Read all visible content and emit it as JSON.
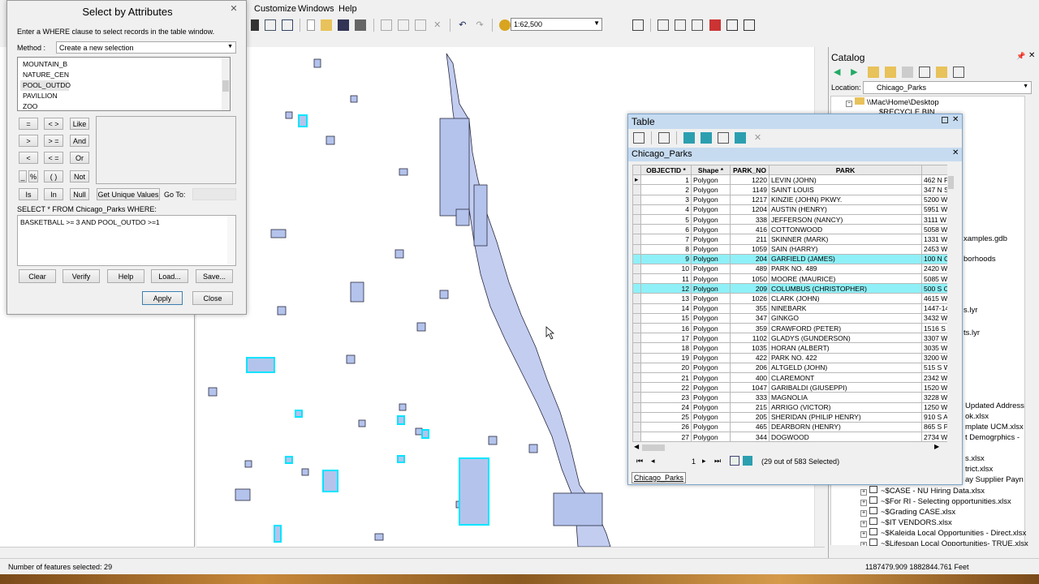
{
  "menu": {
    "items": [
      "Customize",
      "Windows",
      "Help"
    ]
  },
  "toolbar": {
    "scale": "1:62,500"
  },
  "dialog": {
    "title": "Select by Attributes",
    "instructions": "Enter a WHERE clause to select records in the table window.",
    "method_label": "Method :",
    "method_value": "Create a new selection",
    "fields": [
      "MOUNTAIN_B",
      "NATURE_CEN",
      "POOL_OUTDO",
      "PAVILLION",
      "ZOO"
    ],
    "operators": [
      "=",
      "< >",
      "Like",
      ">",
      "> =",
      "And",
      "<",
      "< =",
      "Or",
      "_",
      "%",
      "( )",
      "Not"
    ],
    "is_label": "Is",
    "in_label": "In",
    "null_label": "Null",
    "unique_label": "Get Unique Values",
    "goto_label": "Go To:",
    "select_clause": "SELECT * FROM Chicago_Parks WHERE:",
    "where_text": "BASKETBALL >= 3 AND POOL_OUTDO >=1",
    "clear": "Clear",
    "verify": "Verify",
    "help": "Help",
    "load": "Load...",
    "save": "Save...",
    "apply": "Apply",
    "close": "Close"
  },
  "table": {
    "title": "Table",
    "layer": "Chicago_Parks",
    "columns": [
      "OBJECTID *",
      "Shape *",
      "PARK_NO",
      "PARK"
    ],
    "rows": [
      {
        "id": "1",
        "shape": "Polygon",
        "no": "1220",
        "park": "LEVIN (JOHN)",
        "addr": "462 N Pi",
        "sel": false
      },
      {
        "id": "2",
        "shape": "Polygon",
        "no": "1149",
        "park": "SAINT LOUIS",
        "addr": "347 N S",
        "sel": false
      },
      {
        "id": "3",
        "shape": "Polygon",
        "no": "1217",
        "park": "KINZIE (JOHN) PKWY.",
        "addr": "5200 W",
        "sel": false
      },
      {
        "id": "4",
        "shape": "Polygon",
        "no": "1204",
        "park": "AUSTIN (HENRY)",
        "addr": "5951 W",
        "sel": false
      },
      {
        "id": "5",
        "shape": "Polygon",
        "no": "338",
        "park": "JEFFERSON (NANCY)",
        "addr": "3111 W",
        "sel": false
      },
      {
        "id": "6",
        "shape": "Polygon",
        "no": "416",
        "park": "COTTONWOOD",
        "addr": "5058 W",
        "sel": false
      },
      {
        "id": "7",
        "shape": "Polygon",
        "no": "211",
        "park": "SKINNER (MARK)",
        "addr": "1331 W",
        "sel": false
      },
      {
        "id": "8",
        "shape": "Polygon",
        "no": "1059",
        "park": "SAIN (HARRY)",
        "addr": "2453 W",
        "sel": false
      },
      {
        "id": "9",
        "shape": "Polygon",
        "no": "204",
        "park": "GARFIELD (JAMES)",
        "addr": "100 N C",
        "sel": true
      },
      {
        "id": "10",
        "shape": "Polygon",
        "no": "489",
        "park": "PARK NO. 489",
        "addr": "2420 W",
        "sel": false
      },
      {
        "id": "11",
        "shape": "Polygon",
        "no": "1050",
        "park": "MOORE (MAURICE)",
        "addr": "5085 W",
        "sel": false
      },
      {
        "id": "12",
        "shape": "Polygon",
        "no": "209",
        "park": "COLUMBUS (CHRISTOPHER)",
        "addr": "500 S C",
        "sel": true
      },
      {
        "id": "13",
        "shape": "Polygon",
        "no": "1026",
        "park": "CLARK (JOHN)",
        "addr": "4615 W",
        "sel": false
      },
      {
        "id": "14",
        "shape": "Polygon",
        "no": "355",
        "park": "NINEBARK",
        "addr": "1447-14",
        "sel": false
      },
      {
        "id": "15",
        "shape": "Polygon",
        "no": "347",
        "park": "GINKGO",
        "addr": "3432 W",
        "sel": false
      },
      {
        "id": "16",
        "shape": "Polygon",
        "no": "359",
        "park": "CRAWFORD (PETER)",
        "addr": "1516 S I",
        "sel": false
      },
      {
        "id": "17",
        "shape": "Polygon",
        "no": "1102",
        "park": "GLADYS (GUNDERSON)",
        "addr": "3307 W",
        "sel": false
      },
      {
        "id": "18",
        "shape": "Polygon",
        "no": "1035",
        "park": "HORAN (ALBERT)",
        "addr": "3035 W",
        "sel": false
      },
      {
        "id": "19",
        "shape": "Polygon",
        "no": "422",
        "park": "PARK NO. 422",
        "addr": "3200 W",
        "sel": false
      },
      {
        "id": "20",
        "shape": "Polygon",
        "no": "206",
        "park": "ALTGELD (JOHN)",
        "addr": "515 S W",
        "sel": false
      },
      {
        "id": "21",
        "shape": "Polygon",
        "no": "400",
        "park": "CLAREMONT",
        "addr": "2342 W",
        "sel": false
      },
      {
        "id": "22",
        "shape": "Polygon",
        "no": "1047",
        "park": "GARIBALDI (GIUSEPPI)",
        "addr": "1520 W",
        "sel": false
      },
      {
        "id": "23",
        "shape": "Polygon",
        "no": "333",
        "park": "MAGNOLIA",
        "addr": "3228 W",
        "sel": false
      },
      {
        "id": "24",
        "shape": "Polygon",
        "no": "215",
        "park": "ARRIGO (VICTOR)",
        "addr": "1250 W",
        "sel": false
      },
      {
        "id": "25",
        "shape": "Polygon",
        "no": "205",
        "park": "SHERIDAN (PHILIP HENRY)",
        "addr": "910 S A",
        "sel": false
      },
      {
        "id": "26",
        "shape": "Polygon",
        "no": "465",
        "park": "DEARBORN (HENRY)",
        "addr": "865 S P",
        "sel": false
      },
      {
        "id": "27",
        "shape": "Polygon",
        "no": "344",
        "park": "DOGWOOD",
        "addr": "2734 W",
        "sel": false
      }
    ],
    "page": "1",
    "selected_text": "(29 out of 583 Selected)",
    "tab": "Chicago_Parks"
  },
  "catalog": {
    "title": "Catalog",
    "location_label": "Location:",
    "location_value": "Chicago_Parks",
    "root": "\\\\Mac\\Home\\Desktop",
    "recycle": "$RECYCLE.BIN",
    "partial": [
      "xamples.gdb",
      "borhoods",
      "s.lyr",
      "ts.lyr",
      "Updated Address",
      "ok.xlsx",
      "mplate UCM.xlsx",
      "t Demogrphics -",
      "s.xlsx",
      "trict.xlsx",
      "ay Supplier Payn"
    ],
    "files": [
      "~$CASE - NU Hiring Data.xlsx",
      "~$For RI - Selecting opportunities.xlsx",
      "~$Grading CASE.xlsx",
      "~$IT VENDORS.xlsx",
      "~$Kaleida Local Opportunities - Direct.xlsx",
      "~$Lifespan Local Opportunities- TRUE.xlsx"
    ]
  },
  "status": {
    "left": "Number of features selected: 29",
    "coords": "1187479.909  1882844.761 Feet"
  }
}
